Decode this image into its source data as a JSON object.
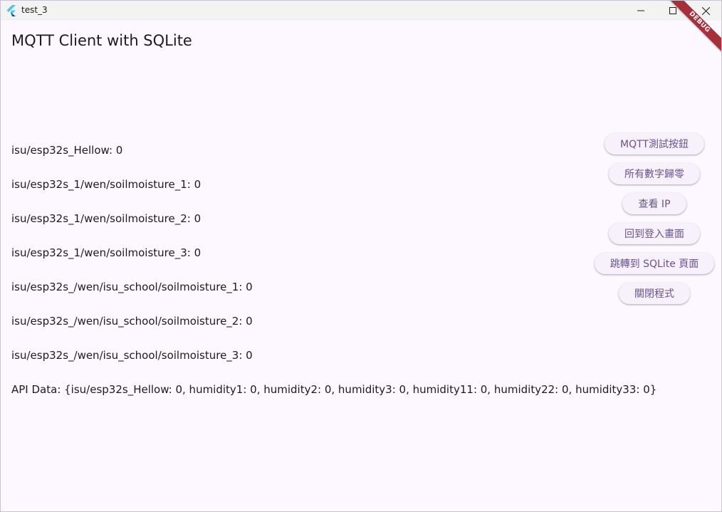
{
  "window": {
    "title": "test_3",
    "icons": {
      "app": "flutter-logo-icon",
      "minimize": "minimize-icon",
      "maximize": "maximize-icon",
      "close": "close-icon"
    }
  },
  "app": {
    "title": "MQTT Client with SQLite",
    "debug_banner": "DEBUG"
  },
  "topics": [
    "isu/esp32s_Hellow: 0",
    "isu/esp32s_1/wen/soilmoisture_1: 0",
    "isu/esp32s_1/wen/soilmoisture_2: 0",
    "isu/esp32s_1/wen/soilmoisture_3: 0",
    "isu/esp32s_/wen/isu_school/soilmoisture_1: 0",
    "isu/esp32s_/wen/isu_school/soilmoisture_2: 0",
    "isu/esp32s_/wen/isu_school/soilmoisture_3: 0"
  ],
  "api_data": "API Data: {isu/esp32s_Hellow: 0, humidity1: 0, humidity2: 0, humidity3: 0, humidity11: 0, humidity22: 0, humidity33: 0}",
  "buttons": {
    "mqtt_test": "MQTT測試按鈕",
    "reset_all": "所有數字歸零",
    "view_ip": "查看 IP",
    "back_to_login": "回到登入畫面",
    "goto_sqlite": "跳轉到 SQLite 頁面",
    "close_app": "關閉程式"
  },
  "colors": {
    "background": "#fdf7ff",
    "button_text": "#65558f",
    "button_bg": "#f7f1fb",
    "debug_banner": "#a6303a"
  }
}
